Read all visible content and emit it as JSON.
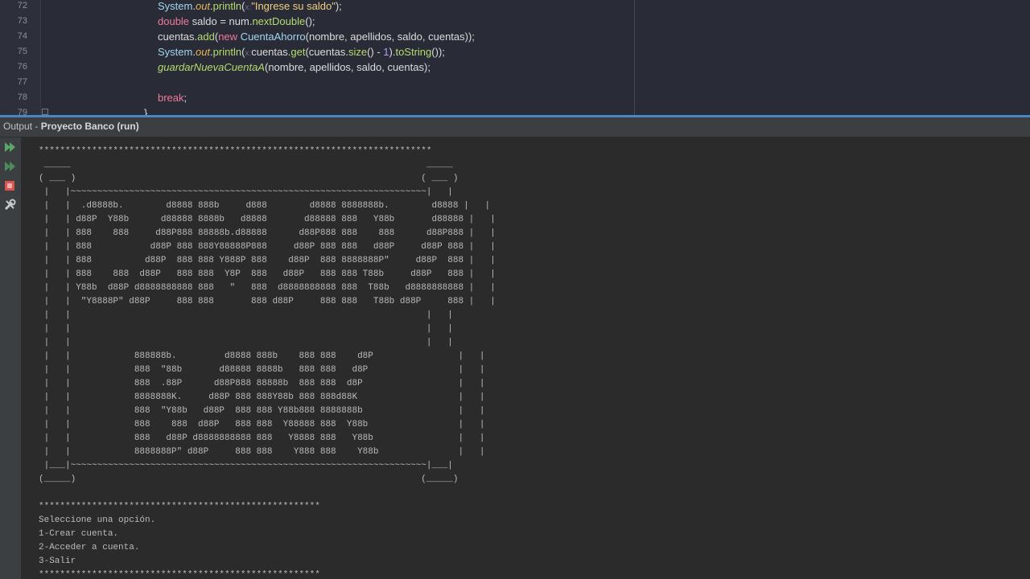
{
  "editor": {
    "line_numbers": [
      "72",
      "73",
      "74",
      "75",
      "76",
      "77",
      "78",
      "79"
    ],
    "lines": [
      {
        "parts": [
          {
            "t": "System",
            "c": "cls"
          },
          {
            "t": "."
          },
          {
            "t": "out",
            "c": "fld"
          },
          {
            "t": "."
          },
          {
            "t": "println",
            "c": "mth"
          },
          {
            "t": "("
          },
          {
            "t": "x:",
            "c": "hint"
          },
          {
            "t": "\"Ingrese su saldo\"",
            "c": "str"
          },
          {
            "t": ");"
          }
        ]
      },
      {
        "parts": [
          {
            "t": "double",
            "c": "kw"
          },
          {
            "t": " saldo = num."
          },
          {
            "t": "nextDouble",
            "c": "mth"
          },
          {
            "t": "();"
          }
        ]
      },
      {
        "parts": [
          {
            "t": "cuentas."
          },
          {
            "t": "add",
            "c": "mth"
          },
          {
            "t": "("
          },
          {
            "t": "new",
            "c": "kw"
          },
          {
            "t": " "
          },
          {
            "t": "CuentaAhorro",
            "c": "cls"
          },
          {
            "t": "(nombre, apellidos, saldo, cuentas));"
          }
        ]
      },
      {
        "parts": [
          {
            "t": "System",
            "c": "cls"
          },
          {
            "t": "."
          },
          {
            "t": "out",
            "c": "fld"
          },
          {
            "t": "."
          },
          {
            "t": "println",
            "c": "mth"
          },
          {
            "t": "("
          },
          {
            "t": "x:",
            "c": "hint"
          },
          {
            "t": "cuentas."
          },
          {
            "t": "get",
            "c": "mth"
          },
          {
            "t": "(cuentas."
          },
          {
            "t": "size",
            "c": "mth"
          },
          {
            "t": "() - "
          },
          {
            "t": "1",
            "c": "num"
          },
          {
            "t": ")."
          },
          {
            "t": "toString",
            "c": "mth"
          },
          {
            "t": "());"
          }
        ]
      },
      {
        "parts": [
          {
            "t": "guardarNuevaCuentaA",
            "c": "ital"
          },
          {
            "t": "(nombre, apellidos, saldo, cuentas);"
          }
        ]
      },
      {
        "parts": []
      },
      {
        "parts": [
          {
            "t": "break",
            "c": "kw"
          },
          {
            "t": ";"
          }
        ]
      },
      {
        "parts": [
          {
            "t": "}"
          }
        ]
      }
    ]
  },
  "output": {
    "title_prefix": "Output - ",
    "process_name": "Proyecto Banco (run)",
    "toolbar": [
      {
        "icon": "rerun-icon",
        "color": "#59a869"
      },
      {
        "icon": "rerun-with-options-icon",
        "color": "#59a869"
      },
      {
        "icon": "stop-icon",
        "color": "#d9534f"
      },
      {
        "icon": "settings-tools-icon",
        "color": "#c8c8c8"
      }
    ],
    "console_text": "**************************************************************************\n _____                                                                   _____\n( ___ )                                                                 ( ___ )\n |   |~~~~~~~~~~~~~~~~~~~~~~~~~~~~~~~~~~~~~~~~~~~~~~~~~~~~~~~~~~~~~~~~~~~|   |\n |   |  .d8888b.        d8888 888b     d888        d8888 8888888b.        d8888 |   |\n |   | d88P  Y88b      d88888 8888b   d8888       d88888 888   Y88b       d88888 |   |\n |   | 888    888     d88P888 88888b.d88888      d88P888 888    888      d88P888 |   |\n |   | 888           d88P 888 888Y88888P888     d88P 888 888   d88P     d88P 888 |   |\n |   | 888          d88P  888 888 Y888P 888    d88P  888 8888888P\"     d88P  888 |   |\n |   | 888    888  d88P   888 888  Y8P  888   d88P   888 888 T88b     d88P   888 |   |\n |   | Y88b  d88P d8888888888 888   \"   888  d8888888888 888  T88b   d8888888888 |   |\n |   |  \"Y8888P\" d88P     888 888       888 d88P     888 888   T88b d88P     888 |   |\n |   |                                                                   |   |\n |   |                                                                   |   |\n |   |                                                                   |   |\n |   |            888888b.         d8888 888b    888 888    d8P                |   |\n |   |            888  \"88b       d88888 8888b   888 888   d8P                 |   |\n |   |            888  .88P      d88P888 88888b  888 888  d8P                  |   |\n |   |            8888888K.     d88P 888 888Y88b 888 888d88K                   |   |\n |   |            888  \"Y88b   d88P  888 888 Y88b888 8888888b                  |   |\n |   |            888    888  d88P   888 888  Y88888 888  Y88b                 |   |\n |   |            888   d88P d8888888888 888   Y8888 888   Y88b                |   |\n |   |            8888888P\" d88P     888 888    Y888 888    Y88b               |   |\n |___|~~~~~~~~~~~~~~~~~~~~~~~~~~~~~~~~~~~~~~~~~~~~~~~~~~~~~~~~~~~~~~~~~~~|___|\n(_____)                                                                 (_____)\n\n*****************************************************\nSeleccione una opción.\n1-Crear cuenta.\n2-Acceder a cuenta.\n3-Salir\n*****************************************************"
  }
}
